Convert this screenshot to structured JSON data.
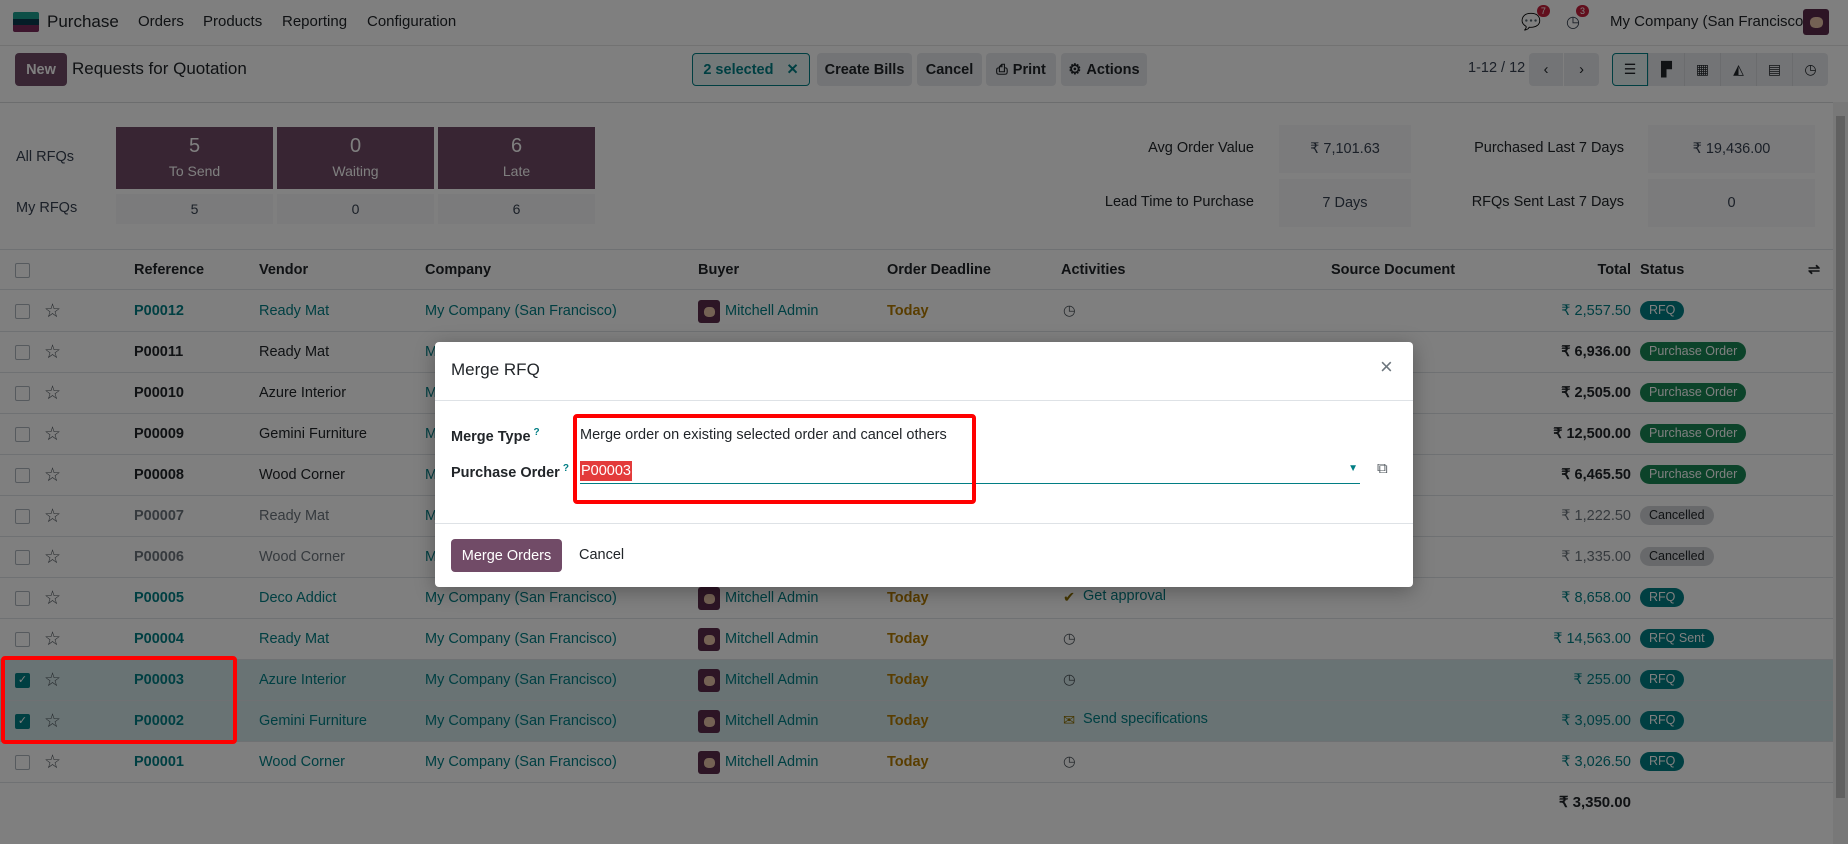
{
  "navbar": {
    "app": "Purchase",
    "menu": [
      "Orders",
      "Products",
      "Reporting",
      "Configuration"
    ],
    "messages_count": "7",
    "activities_count": "3",
    "company": "My Company (San Francisco)",
    "logo_colors": [
      "#1a9e8f",
      "#0b3b4f",
      "#7a2a5a"
    ]
  },
  "control": {
    "new_label": "New",
    "title": "Requests for Quotation",
    "selected_label": "2 selected",
    "create_bills": "Create Bills",
    "cancel": "Cancel",
    "print": "Print",
    "actions": "Actions",
    "pager": "1-12 / 12",
    "views": [
      "list-icon",
      "kanban-icon",
      "pivot-icon",
      "graph-icon",
      "calendar-icon",
      "activity-icon"
    ],
    "active_view": "list-icon"
  },
  "dashboard": {
    "all_label": "All RFQs",
    "my_label": "My RFQs",
    "tiles": [
      {
        "count": "5",
        "label": "To Send",
        "my": "5"
      },
      {
        "count": "0",
        "label": "Waiting",
        "my": "0"
      },
      {
        "count": "6",
        "label": "Late",
        "my": "6"
      }
    ],
    "stats": [
      {
        "label": "Avg Order Value",
        "value": "₹ 7,101.63"
      },
      {
        "label": "Purchased Last 7 Days",
        "value": "₹ 19,436.00"
      },
      {
        "label": "Lead Time to Purchase",
        "value": "7 Days"
      },
      {
        "label": "RFQs Sent Last 7 Days",
        "value": "0"
      }
    ]
  },
  "table": {
    "headers": {
      "reference": "Reference",
      "vendor": "Vendor",
      "company": "Company",
      "buyer": "Buyer",
      "deadline": "Order Deadline",
      "activities": "Activities",
      "source": "Source Document",
      "total": "Total",
      "status": "Status"
    },
    "rows": [
      {
        "reference": "P00012",
        "vendor": "Ready Mat",
        "company": "My Company (San Francisco)",
        "buyer": "Mitchell Admin",
        "deadline": "Today",
        "activity_icon": "clock-icon",
        "activity": "",
        "total": "₹ 2,557.50",
        "status": "RFQ",
        "kind": "rfq",
        "selected": false
      },
      {
        "reference": "P00011",
        "vendor": "Ready Mat",
        "company": "My Company (San Francisco)",
        "total": "₹ 6,936.00",
        "status": "Purchase Order",
        "kind": "po",
        "selected": false
      },
      {
        "reference": "P00010",
        "vendor": "Azure Interior",
        "company": "My Company (San Francisco)",
        "total": "₹ 2,505.00",
        "status": "Purchase Order",
        "kind": "po",
        "selected": false
      },
      {
        "reference": "P00009",
        "vendor": "Gemini Furniture",
        "company": "My Company (San Francisco)",
        "total": "₹ 12,500.00",
        "status": "Purchase Order",
        "kind": "po",
        "selected": false
      },
      {
        "reference": "P00008",
        "vendor": "Wood Corner",
        "company": "My Company (San Francisco)",
        "total": "₹ 6,465.50",
        "status": "Purchase Order",
        "kind": "po",
        "selected": false
      },
      {
        "reference": "P00007",
        "vendor": "Ready Mat",
        "company": "My Company (San Francisco)",
        "total": "₹ 1,222.50",
        "status": "Cancelled",
        "kind": "cancel",
        "selected": false
      },
      {
        "reference": "P00006",
        "vendor": "Wood Corner",
        "company": "My Company (San Francisco)",
        "total": "₹ 1,335.00",
        "status": "Cancelled",
        "kind": "cancel",
        "selected": false
      },
      {
        "reference": "P00005",
        "vendor": "Deco Addict",
        "company": "My Company (San Francisco)",
        "buyer": "Mitchell Admin",
        "deadline": "Today",
        "activity_icon": "check-icon",
        "activity": "Get approval",
        "total": "₹ 8,658.00",
        "status": "RFQ",
        "kind": "rfq",
        "selected": false
      },
      {
        "reference": "P00004",
        "vendor": "Ready Mat",
        "company": "My Company (San Francisco)",
        "buyer": "Mitchell Admin",
        "deadline": "Today",
        "activity_icon": "clock-icon",
        "activity": "",
        "total": "₹ 14,563.00",
        "status": "RFQ Sent",
        "kind": "rfq",
        "selected": false
      },
      {
        "reference": "P00003",
        "vendor": "Azure Interior",
        "company": "My Company (San Francisco)",
        "buyer": "Mitchell Admin",
        "deadline": "Today",
        "activity_icon": "clock-icon",
        "activity": "",
        "total": "₹ 255.00",
        "status": "RFQ",
        "kind": "rfq",
        "selected": true
      },
      {
        "reference": "P00002",
        "vendor": "Gemini Furniture",
        "company": "My Company (San Francisco)",
        "buyer": "Mitchell Admin",
        "deadline": "Today",
        "activity_icon": "envelope-icon",
        "activity": "Send specifications",
        "total": "₹ 3,095.00",
        "status": "RFQ",
        "kind": "rfq",
        "selected": true
      },
      {
        "reference": "P00001",
        "vendor": "Wood Corner",
        "company": "My Company (San Francisco)",
        "buyer": "Mitchell Admin",
        "deadline": "Today",
        "activity_icon": "clock-icon",
        "activity": "",
        "total": "₹ 3,026.50",
        "status": "RFQ",
        "kind": "rfq",
        "selected": false
      }
    ],
    "footer_total": "₹ 3,350.00"
  },
  "modal": {
    "title": "Merge RFQ",
    "merge_type_label": "Merge Type",
    "merge_type_value": "Merge order on existing selected order and cancel others",
    "purchase_order_label": "Purchase Order",
    "purchase_order_value": "P00003",
    "help_mark": "?",
    "merge_button": "Merge Orders",
    "cancel_button": "Cancel"
  },
  "colors": {
    "brand": "#714B67",
    "link": "#017e84",
    "rfq_badge": "#017e84",
    "po_badge": "#198754",
    "cancel_badge": "#d1d3d6",
    "highlight": "#ff0000"
  }
}
